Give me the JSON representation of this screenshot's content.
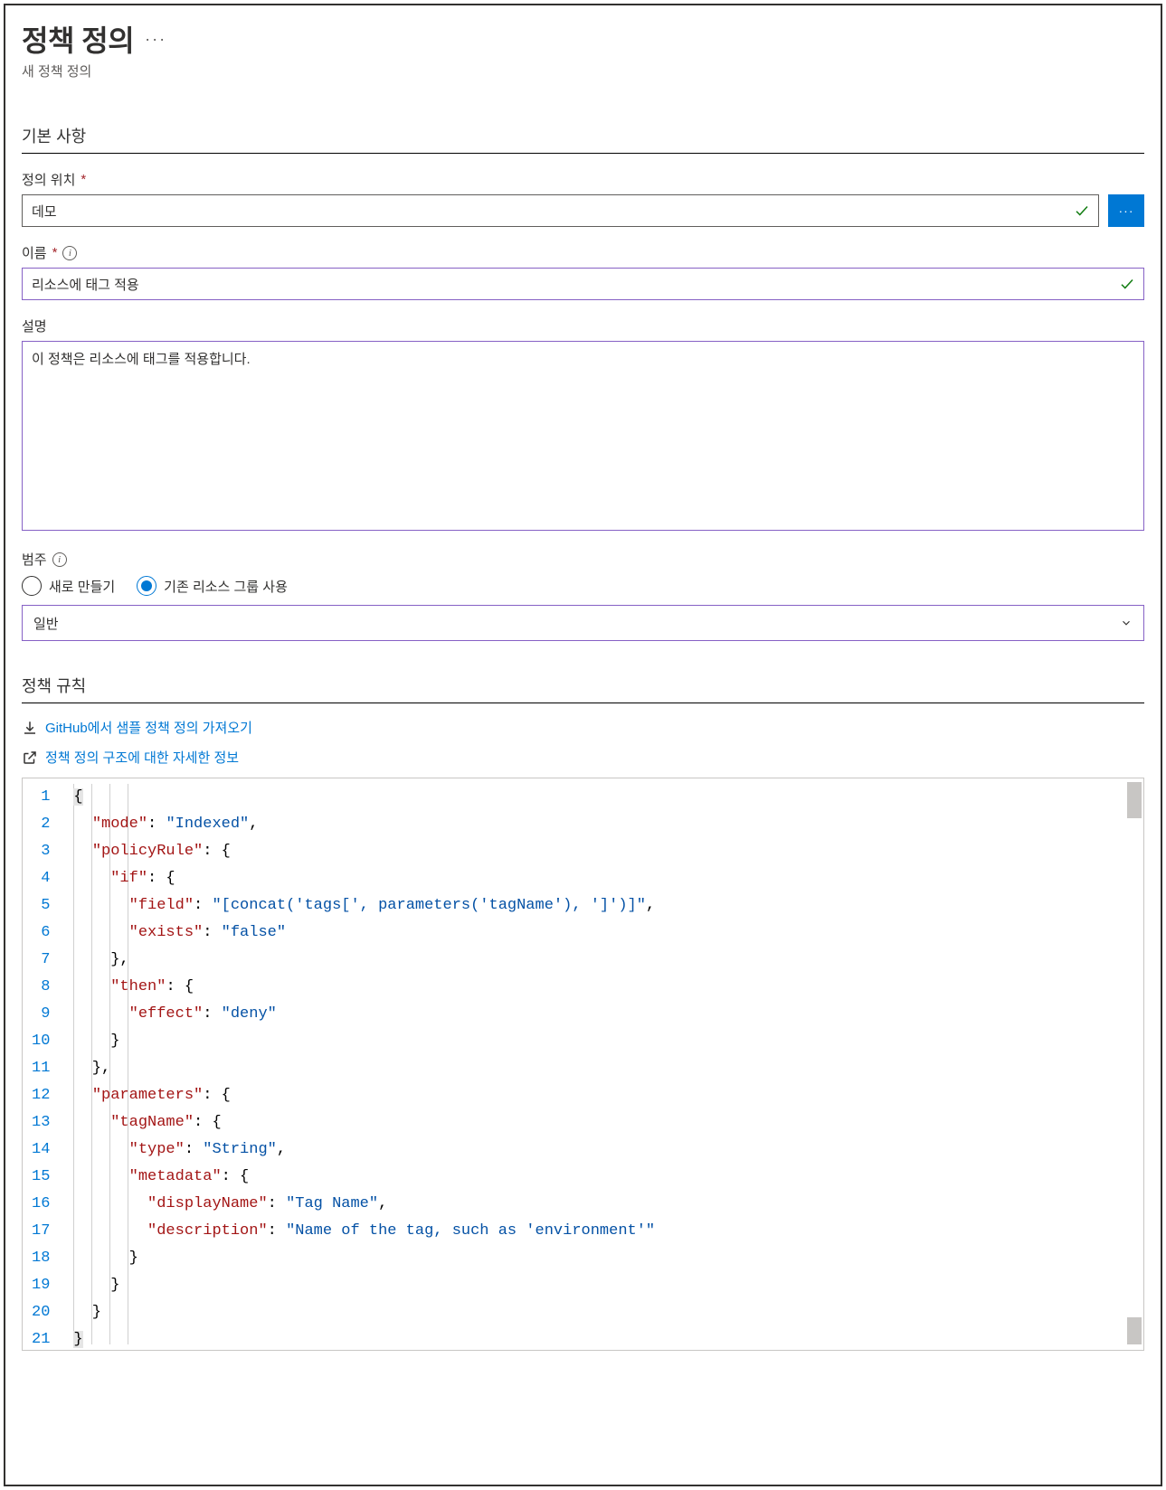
{
  "header": {
    "title": "정책 정의",
    "subtitle": "새 정책 정의"
  },
  "basics": {
    "section_label": "기본 사항",
    "definition_location": {
      "label": "정의 위치",
      "value": "데모"
    },
    "name": {
      "label": "이름",
      "value": "리소스에 태그 적용"
    },
    "description": {
      "label": "설명",
      "value": "이 정책은 리소스에 태그를 적용합니다."
    },
    "category": {
      "label": "범주",
      "options": {
        "create_new": "새로 만들기",
        "use_existing": "기존 리소스 그룹 사용"
      },
      "selected": "use_existing",
      "select_value": "일반"
    }
  },
  "policy_rule": {
    "section_label": "정책 규칙",
    "links": {
      "github": "GitHub에서 샘플 정책 정의 가져오기",
      "structure": "정책 정의 구조에 대한 자세한 정보"
    },
    "code_lines": [
      [
        [
          "punc",
          "{"
        ]
      ],
      [
        [
          "punc",
          "  "
        ],
        [
          "key",
          "\"mode\""
        ],
        [
          "punc",
          ": "
        ],
        [
          "str",
          "\"Indexed\""
        ],
        [
          "punc",
          ","
        ]
      ],
      [
        [
          "punc",
          "  "
        ],
        [
          "key",
          "\"policyRule\""
        ],
        [
          "punc",
          ": {"
        ]
      ],
      [
        [
          "punc",
          "    "
        ],
        [
          "key",
          "\"if\""
        ],
        [
          "punc",
          ": {"
        ]
      ],
      [
        [
          "punc",
          "      "
        ],
        [
          "key",
          "\"field\""
        ],
        [
          "punc",
          ": "
        ],
        [
          "str",
          "\"[concat('tags[', parameters('tagName'), ']')]\""
        ],
        [
          "punc",
          ","
        ]
      ],
      [
        [
          "punc",
          "      "
        ],
        [
          "key",
          "\"exists\""
        ],
        [
          "punc",
          ": "
        ],
        [
          "str",
          "\"false\""
        ]
      ],
      [
        [
          "punc",
          "    },"
        ]
      ],
      [
        [
          "punc",
          "    "
        ],
        [
          "key",
          "\"then\""
        ],
        [
          "punc",
          ": {"
        ]
      ],
      [
        [
          "punc",
          "      "
        ],
        [
          "key",
          "\"effect\""
        ],
        [
          "punc",
          ": "
        ],
        [
          "str",
          "\"deny\""
        ]
      ],
      [
        [
          "punc",
          "    }"
        ]
      ],
      [
        [
          "punc",
          "  },"
        ]
      ],
      [
        [
          "punc",
          "  "
        ],
        [
          "key",
          "\"parameters\""
        ],
        [
          "punc",
          ": {"
        ]
      ],
      [
        [
          "punc",
          "    "
        ],
        [
          "key",
          "\"tagName\""
        ],
        [
          "punc",
          ": {"
        ]
      ],
      [
        [
          "punc",
          "      "
        ],
        [
          "key",
          "\"type\""
        ],
        [
          "punc",
          ": "
        ],
        [
          "str",
          "\"String\""
        ],
        [
          "punc",
          ","
        ]
      ],
      [
        [
          "punc",
          "      "
        ],
        [
          "key",
          "\"metadata\""
        ],
        [
          "punc",
          ": {"
        ]
      ],
      [
        [
          "punc",
          "        "
        ],
        [
          "key",
          "\"displayName\""
        ],
        [
          "punc",
          ": "
        ],
        [
          "str",
          "\"Tag Name\""
        ],
        [
          "punc",
          ","
        ]
      ],
      [
        [
          "punc",
          "        "
        ],
        [
          "key",
          "\"description\""
        ],
        [
          "punc",
          ": "
        ],
        [
          "str",
          "\"Name of the tag, such as 'environment'\""
        ]
      ],
      [
        [
          "punc",
          "      }"
        ]
      ],
      [
        [
          "punc",
          "    }"
        ]
      ],
      [
        [
          "punc",
          "  }"
        ]
      ],
      [
        [
          "punc",
          "}"
        ]
      ]
    ]
  }
}
